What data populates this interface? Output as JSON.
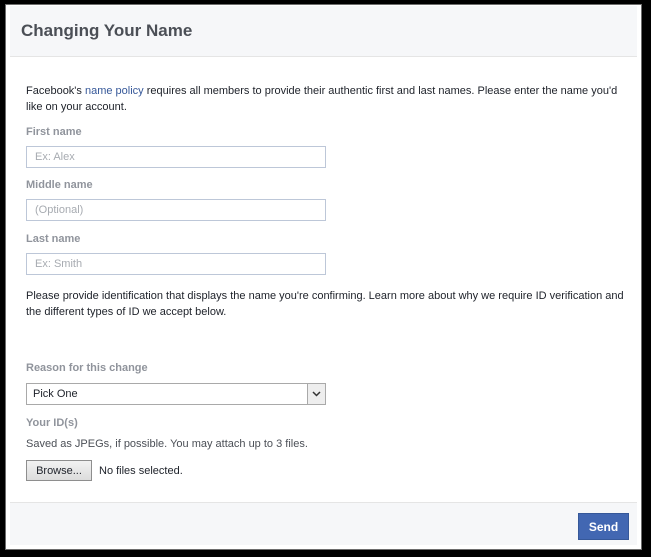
{
  "dialog": {
    "title": "Changing Your Name",
    "intro": {
      "prefix": "Facebook's ",
      "link": "name policy",
      "suffix": " requires all members to provide their authentic first and last names. Please enter the name you'd like on your account."
    },
    "fields": [
      {
        "label": "First name",
        "placeholder": "Ex: Alex",
        "value": ""
      },
      {
        "label": "Middle name",
        "placeholder": "(Optional)",
        "value": ""
      },
      {
        "label": "Last name",
        "placeholder": "Ex: Smith",
        "value": ""
      }
    ],
    "id_text": "Please provide identification that displays the name you're confirming. Learn more about why we require ID verification and the different types of ID we accept below.",
    "reason": {
      "label": "Reason for this change",
      "selected": "Pick One"
    },
    "ids": {
      "label": "Your ID(s)",
      "hint": "Saved as JPEGs, if possible. You may attach up to 3 files.",
      "browse_label": "Browse...",
      "status": "No files selected."
    },
    "send_label": "Send"
  },
  "colors": {
    "accent": "#4267b2",
    "link": "#365899",
    "label": "#90949c",
    "header_bg": "#f6f7f9"
  },
  "icons": {
    "select_arrow": "chevron-down-icon"
  }
}
